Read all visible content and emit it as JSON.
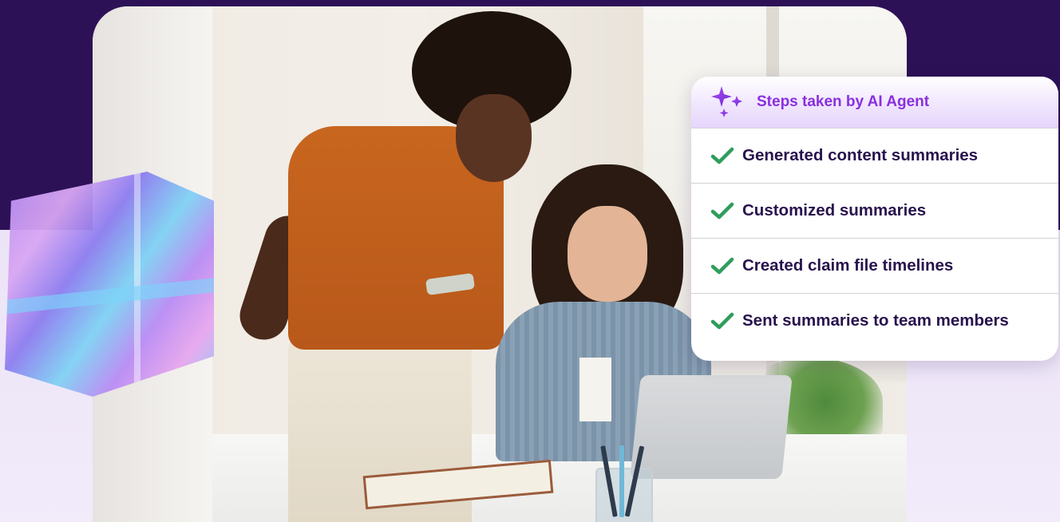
{
  "card": {
    "title": "Steps taken by AI Agent",
    "icon": "sparkles-icon",
    "accent_color": "#8a2fe0",
    "check_color": "#2f9d5c",
    "steps": [
      {
        "label": "Generated content summaries",
        "status": "done"
      },
      {
        "label": "Customized summaries",
        "status": "done"
      },
      {
        "label": "Created claim file timelines",
        "status": "done"
      },
      {
        "label": "Sent summaries to team members",
        "status": "done"
      }
    ]
  },
  "colors": {
    "background_top": "#2d1157",
    "background_bottom": "#f1ebfa"
  }
}
